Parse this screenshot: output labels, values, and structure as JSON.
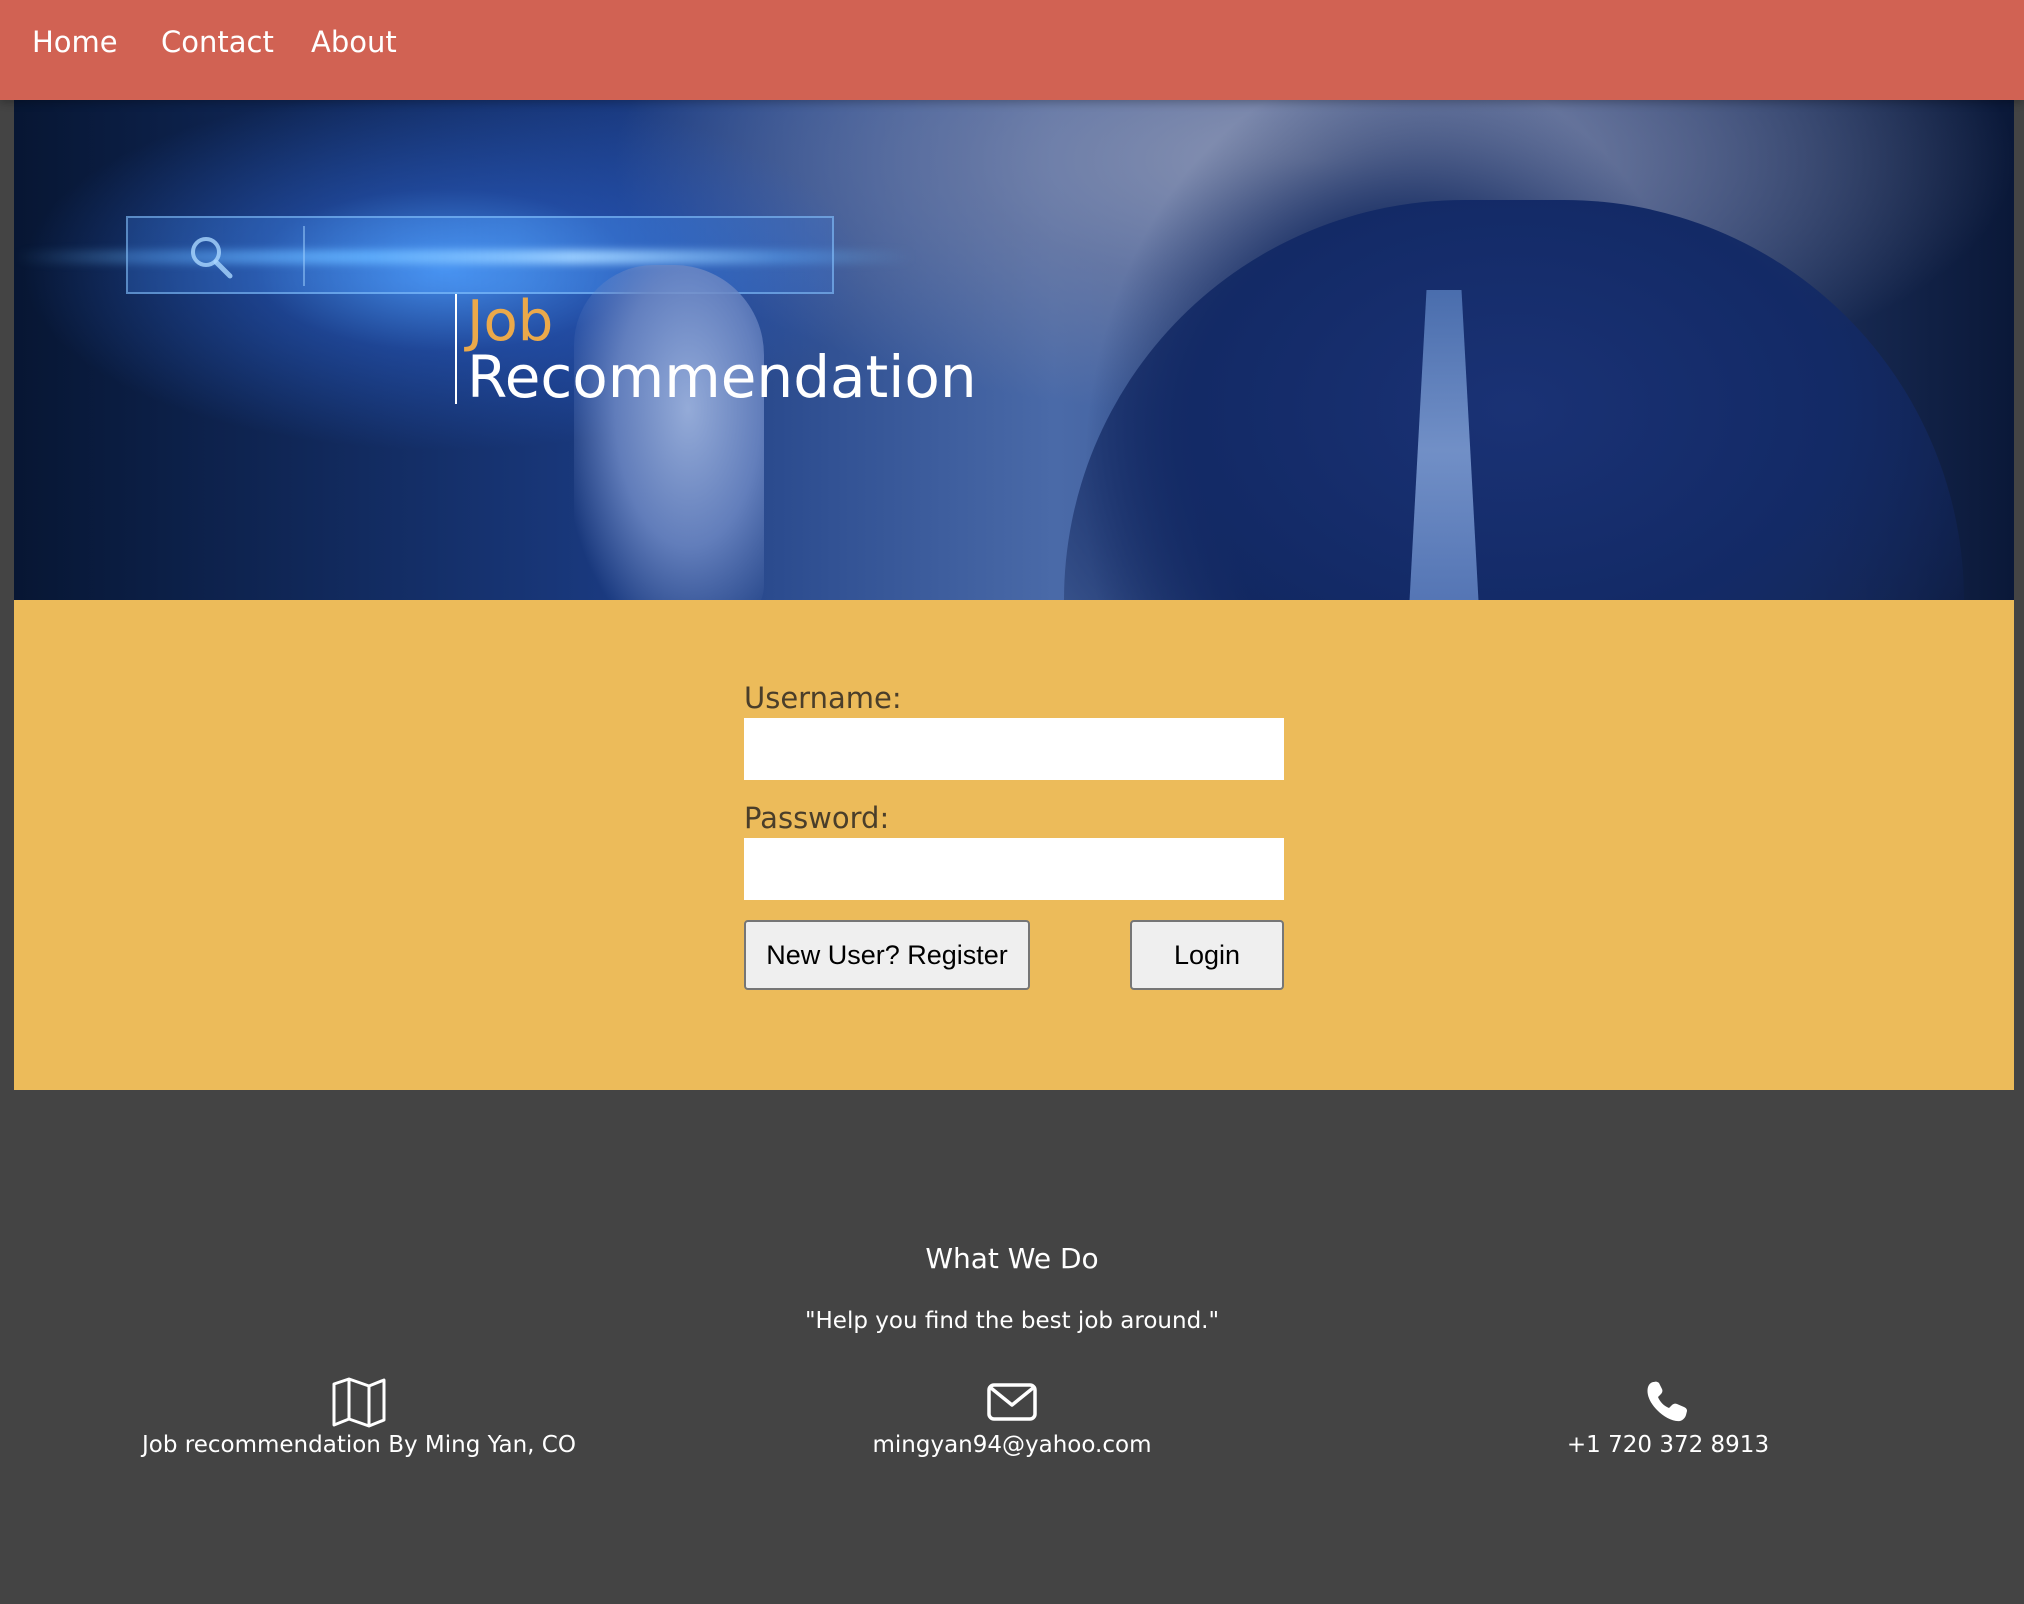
{
  "nav": {
    "home": "Home",
    "contact": "Contact",
    "about": "About"
  },
  "hero": {
    "title_line1": "Job",
    "title_line2": "Recommendation",
    "title_line1_color": "#eba94a"
  },
  "login": {
    "username_label": "Username:",
    "username_value": "",
    "password_label": "Password:",
    "password_value": "",
    "register_button": "New User? Register",
    "login_button": "Login"
  },
  "footer": {
    "heading": "What We Do",
    "tagline": "\"Help you find the best job around.\"",
    "items": [
      {
        "icon": "map-icon",
        "text": "Job recommendation By Ming Yan, CO"
      },
      {
        "icon": "envelope-icon",
        "text": "mingyan94@yahoo.com"
      },
      {
        "icon": "phone-icon",
        "text": "+1 720 372 8913"
      }
    ]
  },
  "colors": {
    "nav_background": "#d16253",
    "login_background": "#ecbb5a",
    "footer_background": "#444444",
    "accent": "#eba94a"
  }
}
